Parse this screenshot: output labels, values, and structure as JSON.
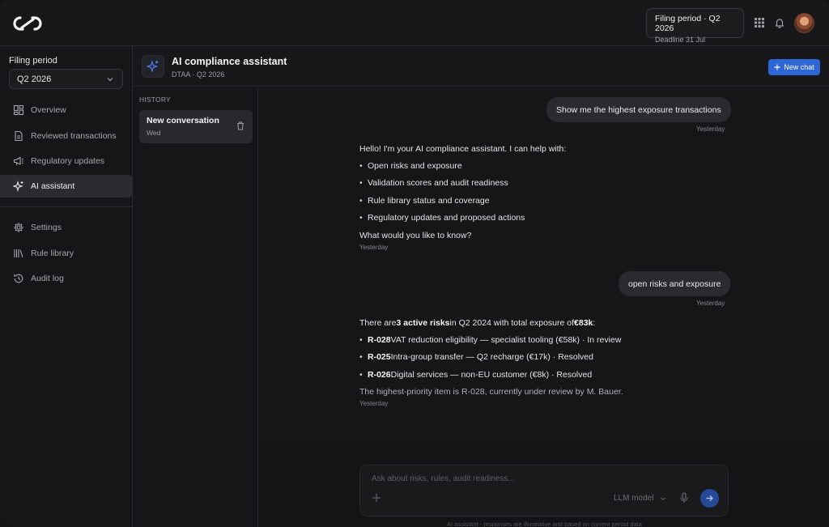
{
  "header": {
    "filing_period_title": "Filing period · Q2 2026",
    "deadline": "Deadline 31 Jul"
  },
  "sidebar": {
    "filing_label": "Filing period",
    "filing_value": "Q2 2026",
    "items": [
      {
        "label": "Overview",
        "icon": "grid-icon"
      },
      {
        "label": "Reviewed transactions",
        "icon": "document-icon"
      },
      {
        "label": "Regulatory updates",
        "icon": "megaphone-icon"
      },
      {
        "label": "AI assistant",
        "icon": "sparkle-icon",
        "active": true
      },
      {
        "label": "Settings",
        "icon": "gear-icon"
      },
      {
        "label": "Rule library",
        "icon": "library-icon"
      },
      {
        "label": "Audit log",
        "icon": "history-icon"
      }
    ]
  },
  "main": {
    "title": "AI compliance assistant",
    "subtitle": "DTAA · Q2 2026",
    "new_chat": "New chat"
  },
  "history": {
    "label": "HISTORY",
    "conversations": [
      {
        "title": "New conversation",
        "day": "Wed"
      }
    ]
  },
  "chat": {
    "messages": [
      {
        "role": "user",
        "text": "Show me the highest exposure transactions",
        "time": "Yesterday"
      },
      {
        "role": "assistant",
        "intro": "Hello! I'm your AI compliance assistant. I can help with:",
        "bullets": [
          "Open risks and exposure",
          "Validation scores and audit readiness",
          "Rule library status and coverage",
          "Regulatory updates and proposed actions"
        ],
        "outro": "What would you like to know?",
        "time": "Yesterday"
      },
      {
        "role": "user",
        "text": "open risks and exposure",
        "time": "Yesterday"
      },
      {
        "role": "assistant",
        "intro_parts": [
          "There are ",
          "3 active risks",
          " in Q2 2024 with total exposure of ",
          "€83k",
          ":"
        ],
        "risks": [
          {
            "id": "R-028",
            "text": " VAT reduction eligibility — specialist tooling (€58k) · In review"
          },
          {
            "id": "R-025",
            "text": " Intra-group transfer — Q2 recharge (€17k) · Resolved"
          },
          {
            "id": "R-026",
            "text": " Digital services — non-EU customer (€8k) · Resolved"
          }
        ],
        "outro": "The highest-priority item is R-028, currently under review by M. Bauer.",
        "time": "Yesterday"
      }
    ]
  },
  "composer": {
    "placeholder": "Ask about risks, rules, audit readiness...",
    "model": "LLM model",
    "disclaimer": "AI assistant - responses are illustrative and based on current period data"
  },
  "colors": {
    "accent": "#2f66d6",
    "background": "#161618",
    "active_nav": "#2c2c30"
  }
}
